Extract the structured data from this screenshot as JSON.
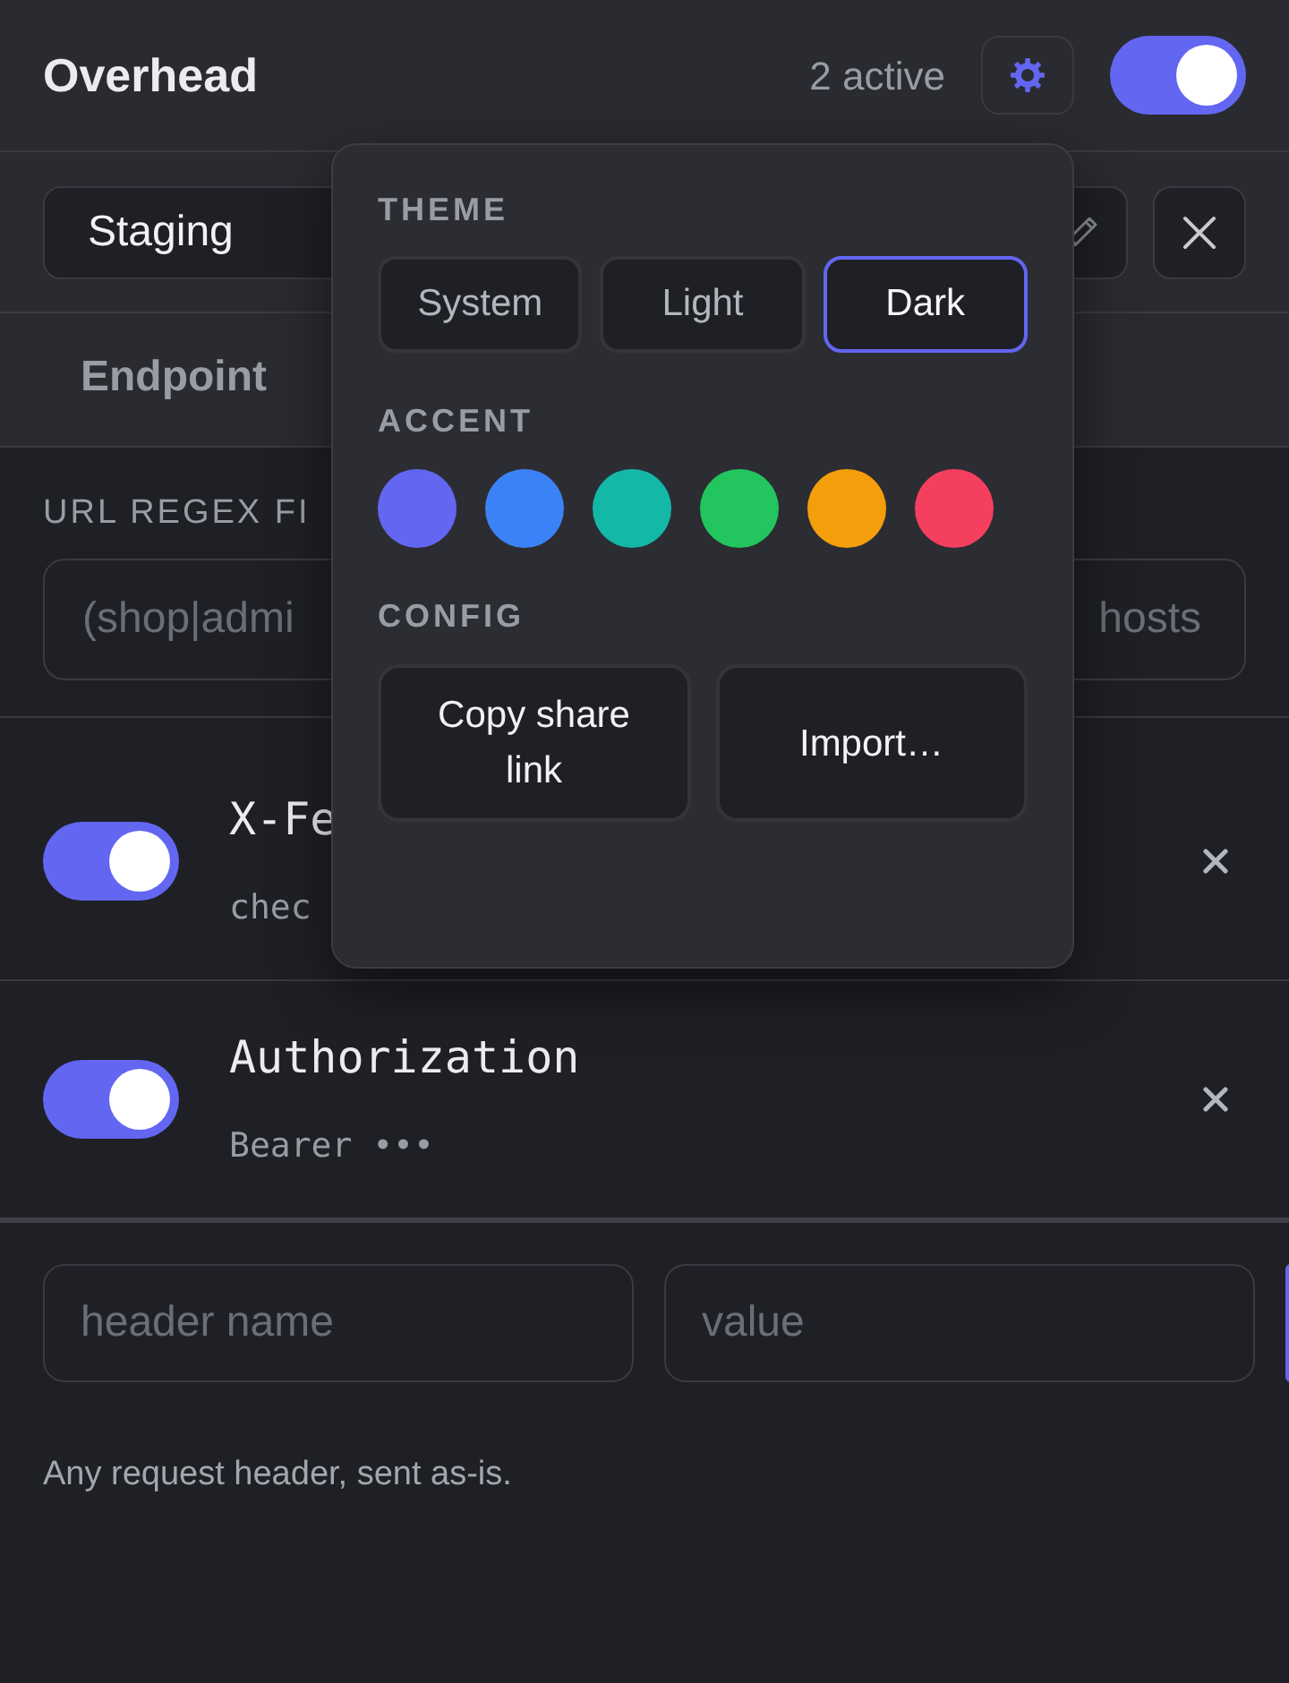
{
  "header": {
    "title": "Overhead",
    "active_count": "2 active",
    "enabled": true
  },
  "profile": {
    "value": "Staging"
  },
  "tabs": [
    {
      "label": "Endpoint",
      "selected": false
    }
  ],
  "url_filter": {
    "label": "URL REGEX FI",
    "placeholder": "(shop|admi",
    "placeholder_tail": "hosts"
  },
  "headers": [
    {
      "name": "X-Fe",
      "value": "chec",
      "enabled": true
    },
    {
      "name": "Authorization",
      "value": "Bearer •••",
      "enabled": true
    }
  ],
  "new_header": {
    "name_placeholder": "header name",
    "value_placeholder": "value"
  },
  "help_text": "Any request header, sent as-is.",
  "settings_popover": {
    "theme_label": "THEME",
    "themes": [
      {
        "label": "System",
        "selected": false
      },
      {
        "label": "Light",
        "selected": false
      },
      {
        "label": "Dark",
        "selected": true
      }
    ],
    "accent_label": "ACCENT",
    "accents": [
      {
        "color": "#6366f1"
      },
      {
        "color": "#3b82f6"
      },
      {
        "color": "#14b8a6"
      },
      {
        "color": "#22c55e"
      },
      {
        "color": "#f59e0b"
      },
      {
        "color": "#f43f5e"
      }
    ],
    "config_label": "CONFIG",
    "actions": [
      "Copy share link",
      "Import…"
    ]
  }
}
